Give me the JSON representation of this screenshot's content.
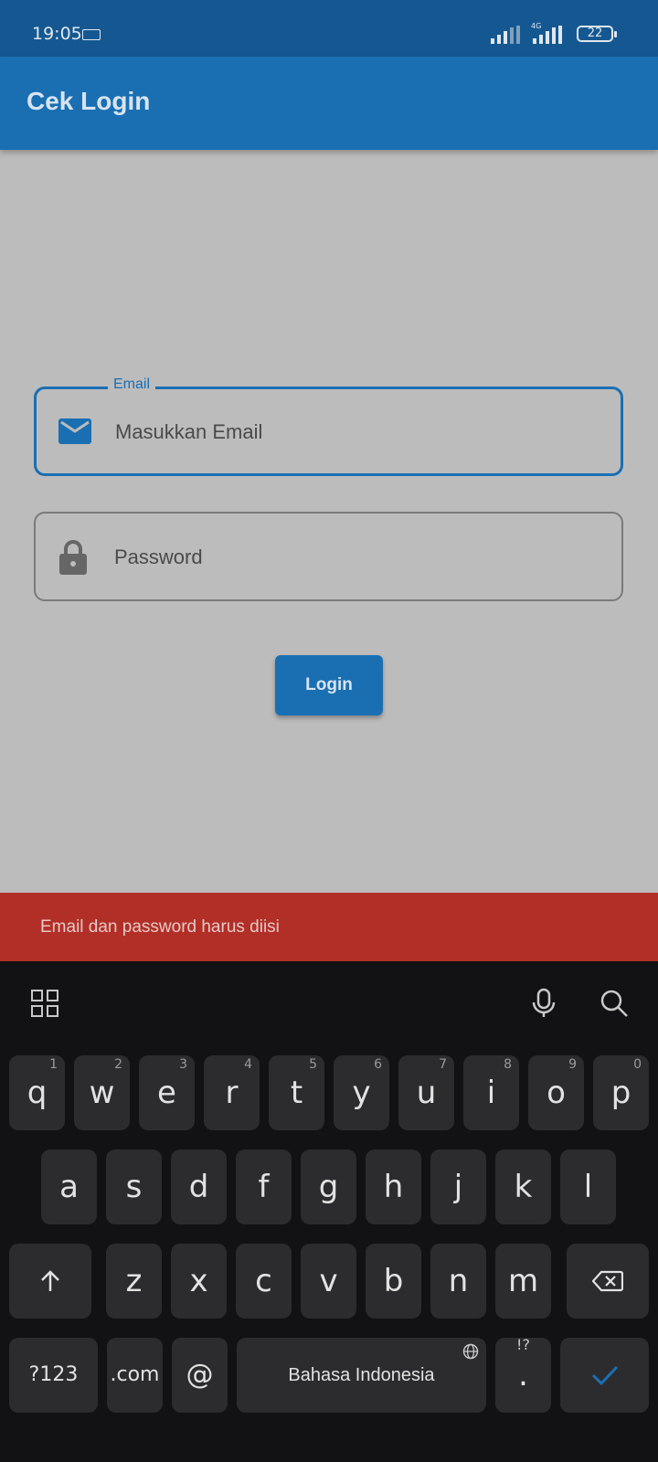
{
  "status_bar": {
    "time": "19:05",
    "battery": "22",
    "network": "4G"
  },
  "app_bar": {
    "title": "Cek Login"
  },
  "form": {
    "email": {
      "label": "Email",
      "placeholder": "Masukkan Email",
      "icon": "mail-icon"
    },
    "password": {
      "placeholder": "Password",
      "icon": "lock-icon"
    },
    "login_button": "Login"
  },
  "snackbar": {
    "message": "Email dan password harus diisi",
    "color": "#b22f27"
  },
  "keyboard": {
    "row1": [
      {
        "key": "q",
        "hint": "1"
      },
      {
        "key": "w",
        "hint": "2"
      },
      {
        "key": "e",
        "hint": "3"
      },
      {
        "key": "r",
        "hint": "4"
      },
      {
        "key": "t",
        "hint": "5"
      },
      {
        "key": "y",
        "hint": "6"
      },
      {
        "key": "u",
        "hint": "7"
      },
      {
        "key": "i",
        "hint": "8"
      },
      {
        "key": "o",
        "hint": "9"
      },
      {
        "key": "p",
        "hint": "0"
      }
    ],
    "row2": [
      "a",
      "s",
      "d",
      "f",
      "g",
      "h",
      "j",
      "k",
      "l"
    ],
    "row3": [
      "z",
      "x",
      "c",
      "v",
      "b",
      "n",
      "m"
    ],
    "symbols_key": "?123",
    "com_key": ".com",
    "at_key": "@",
    "space_key": "Bahasa Indonesia",
    "period_key": ".",
    "period_alt": "!?"
  },
  "colors": {
    "accent": "#1a6fb3",
    "status_bar": "#155891",
    "background": "#bcbcbc",
    "keyboard": "#121214"
  }
}
